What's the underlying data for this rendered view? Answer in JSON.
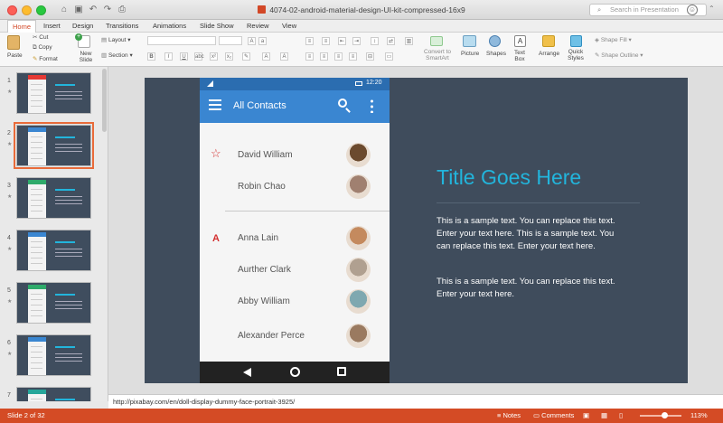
{
  "window": {
    "title": "4074-02-android-material-design-UI-kit-compressed-16x9",
    "search_placeholder": "Search in Presentation"
  },
  "tabs": [
    "Home",
    "Insert",
    "Design",
    "Transitions",
    "Animations",
    "Slide Show",
    "Review",
    "View"
  ],
  "ribbon": {
    "paste": "Paste",
    "cut": "Cut",
    "copy": "Copy",
    "format": "Format",
    "new_slide": "New Slide",
    "layout": "Layout",
    "section": "Section",
    "convert_smartart": "Convert to SmartArt",
    "picture": "Picture",
    "shapes": "Shapes",
    "text_box": "Text Box",
    "arrange": "Arrange",
    "quick_styles": "Quick Styles",
    "shape_fill": "Shape Fill",
    "shape_outline": "Shape Outline"
  },
  "slides_panel": {
    "thumbnails": [
      {
        "num": "1",
        "color": "#e53935"
      },
      {
        "num": "2",
        "color": "#3a86d1"
      },
      {
        "num": "3",
        "color": "#2eaa6a"
      },
      {
        "num": "4",
        "color": "#3a86d1"
      },
      {
        "num": "5",
        "color": "#2eaa6a"
      },
      {
        "num": "6",
        "color": "#3a86d1"
      },
      {
        "num": "7",
        "color": "#26a69a"
      }
    ],
    "selected": "2"
  },
  "phone": {
    "time": "12:20",
    "app_title": "All Contacts",
    "contacts": [
      {
        "name": "David William",
        "section_marker": "star"
      },
      {
        "name": "Robin Chao",
        "section_marker": ""
      },
      {
        "name": "Anna Lain",
        "section_marker": "A"
      },
      {
        "name": "Aurther Clark",
        "section_marker": ""
      },
      {
        "name": "Abby William",
        "section_marker": ""
      },
      {
        "name": "Alexander Perce",
        "section_marker": ""
      }
    ]
  },
  "slide": {
    "title": "Title Goes Here",
    "paragraph1": "This is a sample text. You can replace this text. Enter your text here. This is a sample text. You can replace this text. Enter your text here.",
    "paragraph2": "This is a sample text. You can replace this text. Enter your text here."
  },
  "notes": {
    "line1": "http://pixabay.com/en/doll-display-dummy-face-portrait-3925/"
  },
  "statusbar": {
    "slide_info": "Slide 2 of 32",
    "notes": "Notes",
    "comments": "Comments",
    "zoom": "113%"
  },
  "colors": {
    "accent": "#d24726",
    "slide_bg": "#3f4c5c",
    "title": "#22b5dc",
    "app_bar": "#3a86d1"
  }
}
